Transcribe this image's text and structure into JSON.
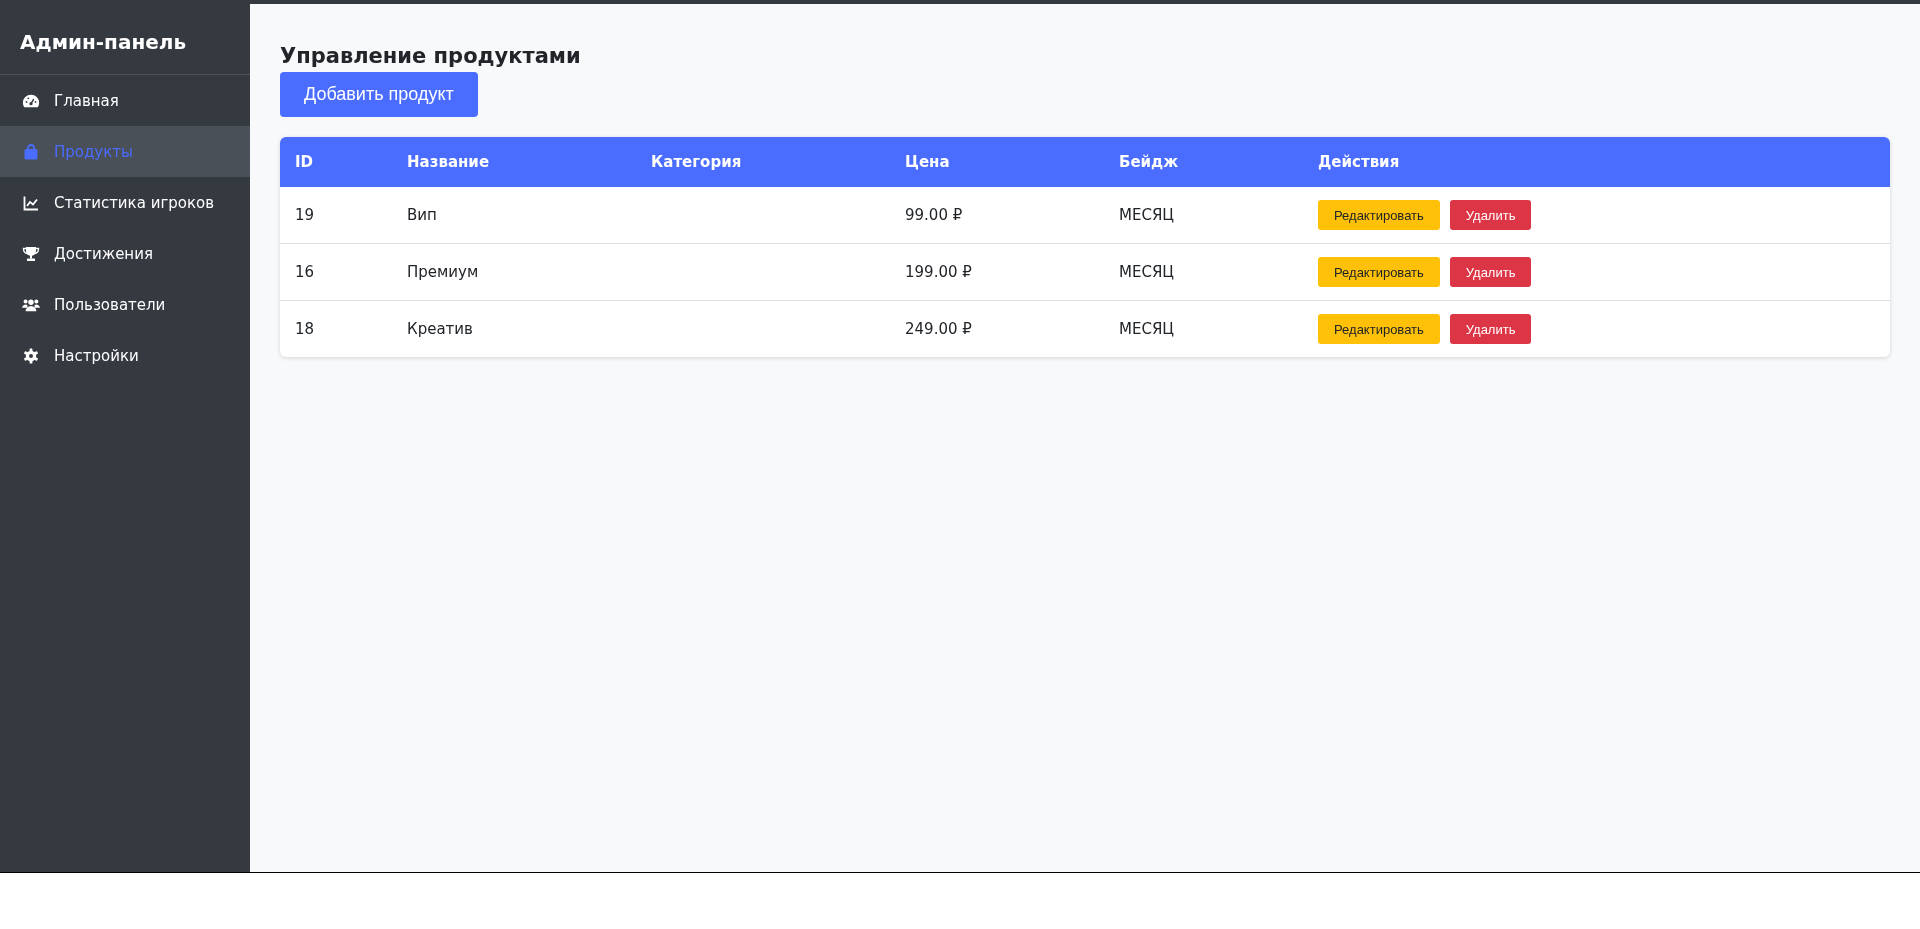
{
  "sidebar": {
    "title": "Админ-панель",
    "items": [
      {
        "label": "Главная",
        "selected": false
      },
      {
        "label": "Продукты",
        "selected": true
      },
      {
        "label": "Статистика игроков",
        "selected": false
      },
      {
        "label": "Достижения",
        "selected": false
      },
      {
        "label": "Пользователи",
        "selected": false
      },
      {
        "label": "Настройки",
        "selected": false
      }
    ]
  },
  "page": {
    "heading": "Управление продуктами",
    "add_button": "Добавить продукт"
  },
  "table": {
    "columns": [
      "ID",
      "Название",
      "Категория",
      "Цена",
      "Бейдж",
      "Действия"
    ],
    "rows": [
      {
        "id": "19",
        "name": "Вип",
        "price": "99.00 ₽",
        "badge": "МЕСЯЦ",
        "edit": "Редактировать",
        "delete": "Удалить"
      },
      {
        "id": "16",
        "name": "Премиум",
        "price": "199.00 ₽",
        "badge": "МЕСЯЦ",
        "edit": "Редактировать",
        "delete": "Удалить"
      },
      {
        "id": "18",
        "name": "Креатив",
        "price": "249.00 ₽",
        "badge": "МЕСЯЦ",
        "edit": "Редактировать",
        "delete": "Удалить"
      }
    ]
  }
}
